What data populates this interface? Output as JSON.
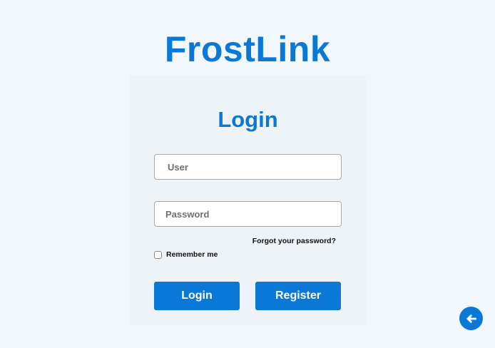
{
  "app": {
    "brand": "FrostLink"
  },
  "login_form": {
    "title": "Login",
    "user_placeholder": "User",
    "password_placeholder": "Password",
    "forgot_password_link": "Forgot your password?",
    "remember_me_label": "Remember me",
    "remember_me_checked": false,
    "login_button": "Login",
    "register_button": "Register"
  },
  "floating_action": {
    "icon": "arrow-left-icon"
  },
  "colors": {
    "page_background": "#f2f7fd",
    "card_background": "#eef3f8",
    "accent": "#0a78d6",
    "button_text": "#ffffff"
  }
}
